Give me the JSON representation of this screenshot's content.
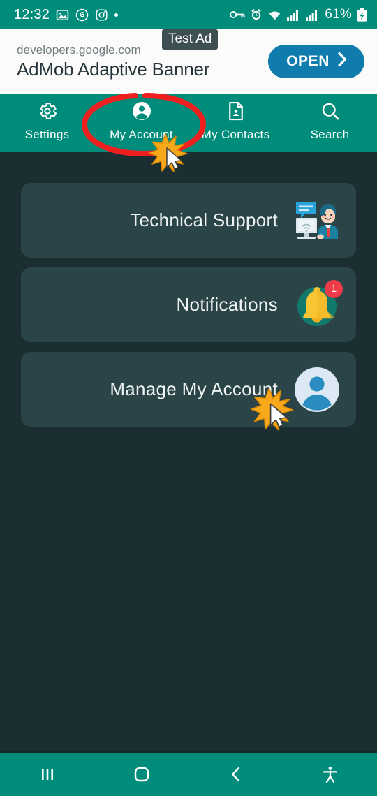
{
  "status_bar": {
    "time": "12:32",
    "battery_percent": "61%",
    "left_icons": [
      "photos-icon",
      "threads-icon",
      "instagram-icon",
      "dot-indicator"
    ],
    "right_icons": [
      "vpn-key-icon",
      "alarm-icon",
      "wifi-icon",
      "signal-icon",
      "signal-icon-2",
      "battery-charging-icon"
    ],
    "bg_color": "#008c7a"
  },
  "ad": {
    "badge_label": "Test Ad",
    "url": "developers.google.com",
    "title": "AdMob Adaptive Banner",
    "open_label": "OPEN",
    "open_color": "#0f7cad",
    "bg_color": "#fbfbf9"
  },
  "tabs": [
    {
      "label": "Settings",
      "icon": "gear-icon",
      "selected": false
    },
    {
      "label": "My  Account",
      "icon": "account-circle-icon",
      "selected": true
    },
    {
      "label": "My  Contacts",
      "icon": "contact-card-icon",
      "selected": false
    },
    {
      "label": "Search",
      "icon": "search-icon",
      "selected": false
    }
  ],
  "cards": [
    {
      "label": "Technical Support",
      "art": "support-agent-illustration"
    },
    {
      "label": "Notifications",
      "art": "bell-icon",
      "badge_count": "1"
    },
    {
      "label": "Manage My Account",
      "art": "avatar-icon"
    }
  ],
  "annotations": {
    "highlight_ellipse": {
      "target": "My  Account",
      "color": "#ef1f1f"
    },
    "click_markers": [
      {
        "target": "My  Account tab",
        "color": "#f5a623"
      },
      {
        "target": "Manage My Account card",
        "color": "#f5a623"
      }
    ]
  },
  "nav_bar": {
    "bg_color": "#008c7a",
    "buttons": [
      {
        "name": "recents-icon"
      },
      {
        "name": "home-icon"
      },
      {
        "name": "back-icon"
      },
      {
        "name": "accessibility-icon"
      }
    ]
  },
  "theme": {
    "page_bg": "#1b2f33",
    "card_bg": "#2b4448",
    "accent": "#008c7a"
  }
}
